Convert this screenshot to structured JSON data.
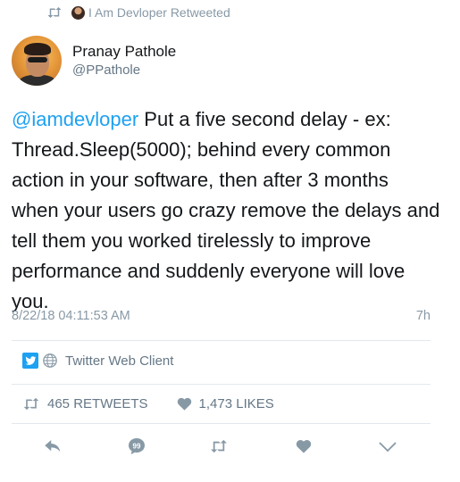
{
  "retweet_banner": {
    "text": "I Am Devloper Retweeted"
  },
  "author": {
    "display_name": "Pranay Pathole",
    "handle": "@PPathole"
  },
  "tweet": {
    "mention": "@iamdevloper",
    "body": " Put a five second delay - ex: Thread.Sleep(5000); behind every common action in your software, then after 3 months when your users go crazy remove the delays and tell them you worked tirelessly to improve performance and suddenly everyone will love you."
  },
  "meta": {
    "timestamp": "8/22/18 04:11:53 AM",
    "relative_time": "7h"
  },
  "client": {
    "label": "Twitter Web Client"
  },
  "stats": {
    "retweets_count": "465",
    "retweets_label": "RETWEETS",
    "likes_count": "1,473",
    "likes_label": "LIKES"
  },
  "colors": {
    "accent": "#1da1f2",
    "muted": "#8899a6",
    "text": "#14171a",
    "divider": "#e1e8ed"
  },
  "icons": [
    "retweet-icon",
    "avatar",
    "twitter-logo-icon",
    "globe-icon",
    "heart-icon",
    "reply-icon",
    "dm-icon",
    "share-icon",
    "chevron-down-icon"
  ]
}
